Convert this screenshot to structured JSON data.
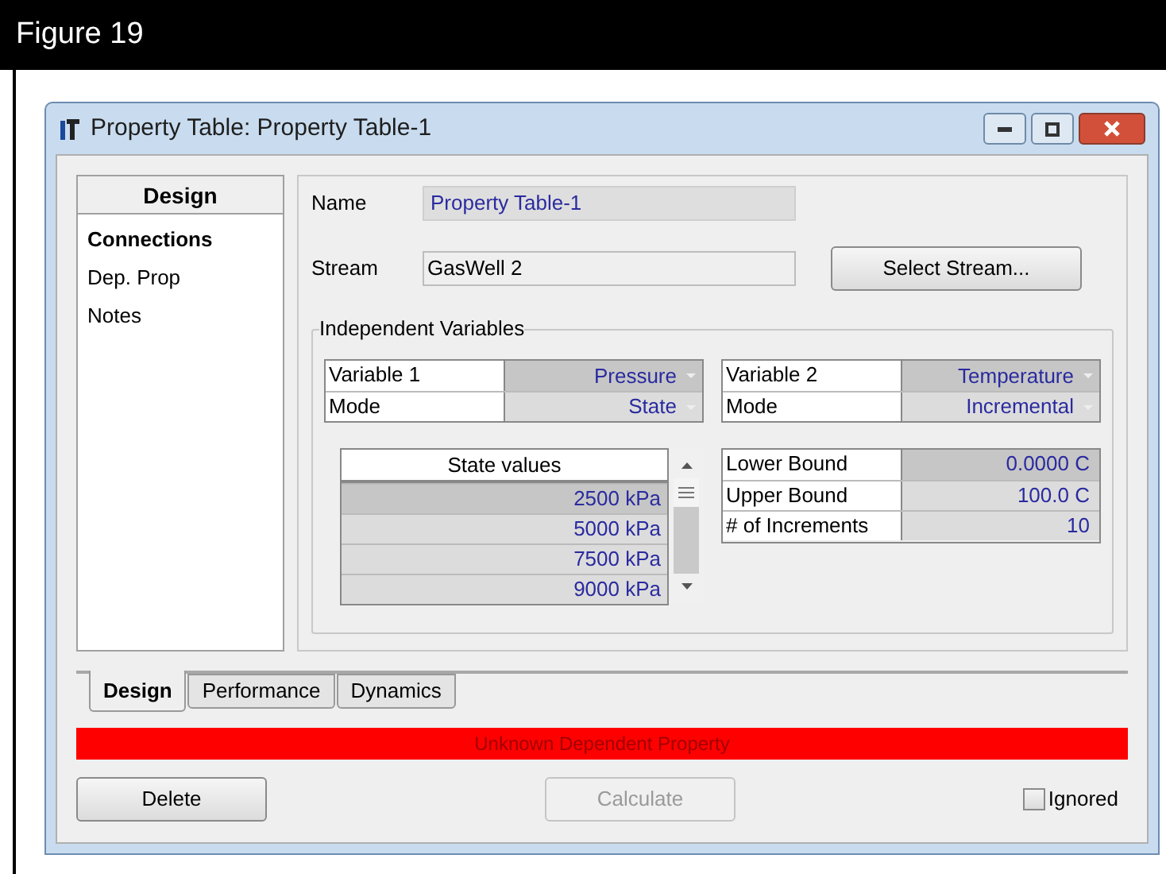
{
  "figure_caption": "Figure 19",
  "window": {
    "title": "Property Table: Property Table-1"
  },
  "sidebar": {
    "header": "Design",
    "items": [
      {
        "label": "Connections",
        "selected": true
      },
      {
        "label": "Dep. Prop",
        "selected": false
      },
      {
        "label": "Notes",
        "selected": false
      }
    ]
  },
  "name_field": {
    "label": "Name",
    "value": "Property Table-1"
  },
  "stream_field": {
    "label": "Stream",
    "value": "GasWell 2"
  },
  "select_stream_button": "Select Stream...",
  "group": {
    "title": "Independent Variables"
  },
  "variable_1": [
    {
      "label": "Variable 1",
      "value": "Pressure"
    },
    {
      "label": "Mode",
      "value": "State"
    }
  ],
  "variable_2": [
    {
      "label": "Variable 2",
      "value": "Temperature"
    },
    {
      "label": "Mode",
      "value": "Incremental"
    }
  ],
  "state_values": {
    "header": "State values",
    "rows": [
      "2500 kPa",
      "5000 kPa",
      "7500 kPa",
      "9000 kPa"
    ]
  },
  "bounds": [
    {
      "label": "Lower Bound",
      "value": "0.0000 C"
    },
    {
      "label": "Upper Bound",
      "value": "100.0 C"
    },
    {
      "label": "# of Increments",
      "value": "10"
    }
  ],
  "tabs": [
    {
      "label": "Design",
      "selected": true
    },
    {
      "label": "Performance",
      "selected": false
    },
    {
      "label": "Dynamics",
      "selected": false
    }
  ],
  "status": "Unknown Dependent Property",
  "buttons": [
    {
      "label": "Delete",
      "disabled": false
    },
    {
      "label": "Calculate",
      "disabled": true
    }
  ],
  "ignored": {
    "label": "Ignored",
    "checked": false
  }
}
